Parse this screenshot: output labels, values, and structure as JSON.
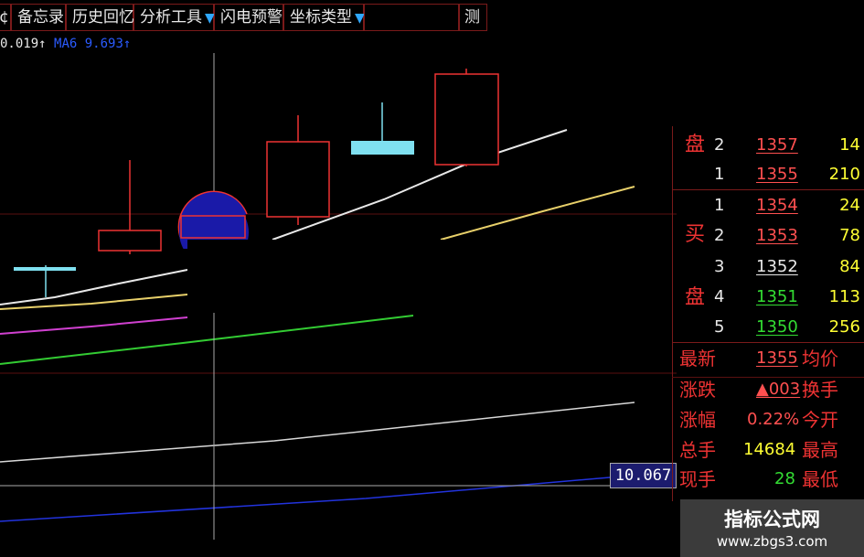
{
  "toolbar": {
    "edge_char": "¢",
    "items": [
      "备忘录",
      "历史回忆",
      "分析工具",
      "闪电预警",
      "坐标类型",
      "测"
    ],
    "dropdown_arrow": "▼"
  },
  "readout": {
    "first": "0.019↑",
    "label": "MA6",
    "value": "9.693↑",
    "colors": {
      "first": "#e8e8e8",
      "label": "#2b5bff",
      "value": "#2b5bff"
    }
  },
  "order_book": {
    "sell_label": "盘",
    "buy_label_1": "买",
    "buy_label_2": "盘",
    "sell": [
      {
        "level": "2",
        "price": "1357",
        "volume": "14",
        "price_color": "#ff5050"
      },
      {
        "level": "1",
        "price": "1355",
        "volume": "210",
        "price_color": "#ff5050"
      }
    ],
    "buy": [
      {
        "level": "1",
        "price": "1354",
        "volume": "24",
        "price_color": "#ff5050"
      },
      {
        "level": "2",
        "price": "1353",
        "volume": "78",
        "price_color": "#ff5050"
      },
      {
        "level": "3",
        "price": "1352",
        "volume": "84",
        "price_color": "#e8e8e8"
      },
      {
        "level": "4",
        "price": "1351",
        "volume": "113",
        "price_color": "#33dd33"
      },
      {
        "level": "5",
        "price": "1350",
        "volume": "256",
        "price_color": "#33dd33"
      }
    ],
    "volume_color": "#ffff33"
  },
  "quote": {
    "rows": [
      {
        "label": "最新",
        "value": "1355",
        "right": "均价",
        "value_color": "#ff5050"
      },
      {
        "label": "涨跌",
        "value": "▲003",
        "right": "换手",
        "value_color": "#ff5050"
      },
      {
        "label": "涨幅",
        "value": "0.22%",
        "right": "今开",
        "value_color": "#ff5050"
      },
      {
        "label": "总手",
        "value": "14684",
        "right": "最高",
        "value_color": "#ffff33"
      },
      {
        "label": "现手",
        "value": "28",
        "right": "最低",
        "value_color": "#33dd33"
      }
    ]
  },
  "crosshair_price": "10.067",
  "watermark": {
    "title": "指标公式网",
    "url": "www.zbgs3.com"
  },
  "chart_data": {
    "type": "candlestick",
    "candles": [
      {
        "open": 1,
        "close": 1,
        "color": "#7fe0f0",
        "note": "doji"
      },
      {
        "open": 3,
        "close": 4,
        "color": "#e33"
      },
      {
        "open": 5,
        "close": 6,
        "color": "#e33"
      },
      {
        "open": 7,
        "close": 9,
        "color": "#e33"
      },
      {
        "open": 10,
        "close": 9.6,
        "color": "#7fe0f0"
      },
      {
        "open": 9,
        "close": 12,
        "color": "#e33"
      }
    ],
    "moving_average_colors": [
      "#e8e8e8",
      "#e8d06a",
      "#d040d0",
      "#33cc33",
      "#d8d8d8",
      "#2233dd"
    ]
  }
}
